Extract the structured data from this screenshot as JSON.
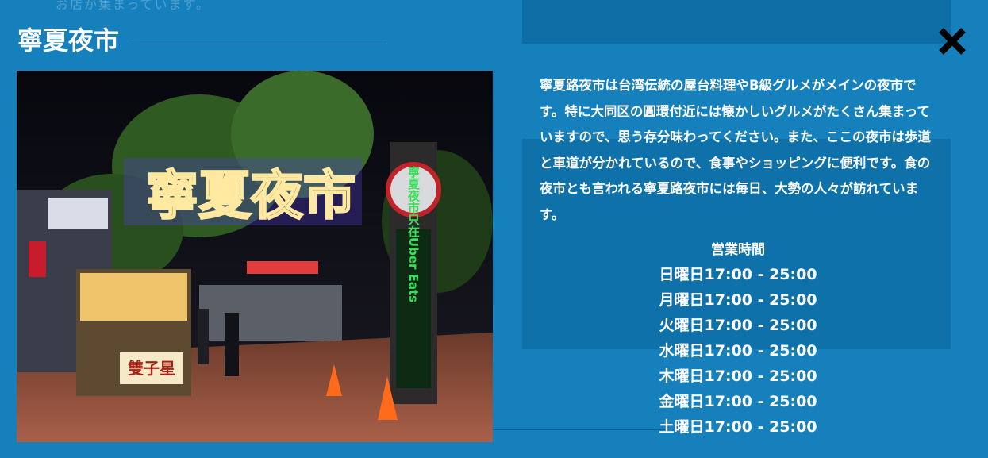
{
  "background_snippet": "お店が集まっています。",
  "title": "寧夏夜市",
  "close_icon": "close-x-icon",
  "photo": {
    "sign_main": "寧夏夜市",
    "pillar_text": "寧夏夜市只在Uber Eats",
    "stall_sign": "雙子星"
  },
  "description": "寧夏路夜市は台湾伝統の屋台料理やB級グルメがメインの夜市です。特に大同区の圓環付近には懐かしいグルメがたくさん集まっていますので、思う存分味わってください。また、ここの夜市は歩道と車道が分かれているので、食事やショッピングに便利です。食の夜市とも言われる寧夏路夜市には毎日、大勢の人々が訪れています。",
  "hours": {
    "title": "営業時間",
    "rows": [
      {
        "day": "日曜日",
        "time": "17:00 - 25:00"
      },
      {
        "day": "月曜日",
        "time": "17:00 - 25:00"
      },
      {
        "day": "火曜日",
        "time": "17:00 - 25:00"
      },
      {
        "day": "水曜日",
        "time": "17:00 - 25:00"
      },
      {
        "day": "木曜日",
        "time": "17:00 - 25:00"
      },
      {
        "day": "金曜日",
        "time": "17:00 - 25:00"
      },
      {
        "day": "土曜日",
        "time": "17:00 - 25:00"
      }
    ]
  },
  "colors": {
    "background": "#1680bd",
    "panel": "#0f71aa",
    "text": "#ffffff",
    "close_icon": "#000000"
  }
}
